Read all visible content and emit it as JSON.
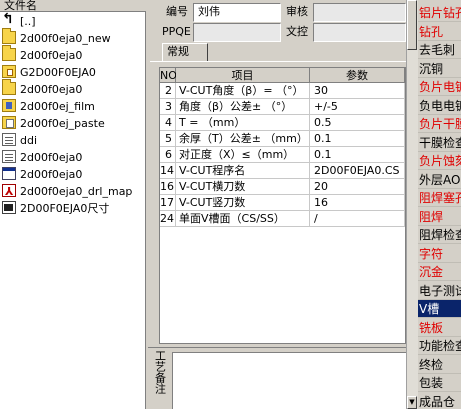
{
  "file_panel": {
    "header": "文件名",
    "items": [
      {
        "name": "[..]",
        "icon": "up-folder-icon"
      },
      {
        "name": "2d00f0eja0_new",
        "icon": "folder-icon"
      },
      {
        "name": "2d00f0eja0",
        "icon": "folder-icon"
      },
      {
        "name": "G2D00F0EJA0",
        "icon": "gcode-folder-icon"
      },
      {
        "name": "2d00f0eja0",
        "icon": "folder-icon"
      },
      {
        "name": "2d00f0ej_film",
        "icon": "film-folder-icon"
      },
      {
        "name": "2d00f0ej_paste",
        "icon": "paste-folder-icon"
      },
      {
        "name": "ddi",
        "icon": "document-icon"
      },
      {
        "name": "2d00f0eja0",
        "icon": "document-icon"
      },
      {
        "name": "2d00f0eja0",
        "icon": "window-file-icon"
      },
      {
        "name": "2d00f0eja0_drl_map",
        "icon": "pdf-icon"
      },
      {
        "name": "2D00F0EJA0尺寸",
        "icon": "cad-file-icon"
      }
    ]
  },
  "form": {
    "editor_label": "编号",
    "editor_value": "刘伟",
    "review_label": "审核",
    "review_value": "",
    "ppqe_label": "PPQE",
    "ppqe_value": "",
    "control_label": "文控",
    "control_value": ""
  },
  "tab": {
    "label": "常规"
  },
  "grid": {
    "headers": {
      "no": "NO",
      "item": "项目",
      "param": "参数"
    },
    "rows": [
      {
        "no": "2",
        "item": "V-CUT角度（β）=  （°）",
        "value": "30"
      },
      {
        "no": "3",
        "item": "角度（β）公差±  （°）",
        "value": "+/-5"
      },
      {
        "no": "4",
        "item": "T =  （mm）",
        "value": "0.5"
      },
      {
        "no": "5",
        "item": "余厚（T）公差±  （mm）",
        "value": "0.1"
      },
      {
        "no": "6",
        "item": "对正度（X）≤（mm）",
        "value": "0.1"
      },
      {
        "no": "14",
        "item": "V-CUT程序名",
        "value": "2D00F0EJA0.CS"
      },
      {
        "no": "16",
        "item": "V-CUT横刀数",
        "value": "20"
      },
      {
        "no": "17",
        "item": "V-CUT竖刀数",
        "value": "16"
      },
      {
        "no": "24",
        "item": "单面V槽面（CS/SS）",
        "value": "/"
      }
    ]
  },
  "notes": {
    "label": "工艺备注",
    "value": ""
  },
  "process_list": {
    "items": [
      {
        "label": "铝片钻孔",
        "color": "red"
      },
      {
        "label": "钻孔",
        "color": "red"
      },
      {
        "label": "去毛刺",
        "color": "black"
      },
      {
        "label": "沉铜",
        "color": "black"
      },
      {
        "label": "负片电镀",
        "color": "red"
      },
      {
        "label": "负电电镀",
        "color": "black"
      },
      {
        "label": "负片干膜",
        "color": "red"
      },
      {
        "label": "干膜检查",
        "color": "black"
      },
      {
        "label": "负片蚀刻",
        "color": "red"
      },
      {
        "label": "外层AOI",
        "color": "black"
      },
      {
        "label": "阻焊塞孔",
        "color": "red"
      },
      {
        "label": "阻焊",
        "color": "red"
      },
      {
        "label": "阻焊检查",
        "color": "black"
      },
      {
        "label": "字符",
        "color": "red"
      },
      {
        "label": "沉金",
        "color": "red"
      },
      {
        "label": "电子测试",
        "color": "black"
      },
      {
        "label": "V槽",
        "color": "selected"
      },
      {
        "label": "铣板",
        "color": "red"
      },
      {
        "label": "功能检查",
        "color": "black"
      },
      {
        "label": "终检",
        "color": "black"
      },
      {
        "label": "包装",
        "color": "black"
      },
      {
        "label": "成品仓",
        "color": "black"
      }
    ]
  }
}
